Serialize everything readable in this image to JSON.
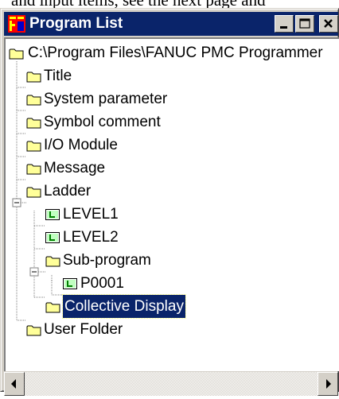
{
  "doc_snippet": "and input items, see the next page and",
  "window": {
    "title": "Program List",
    "icon": "fanuc-program-list-icon",
    "buttons": [
      "minimize",
      "maximize",
      "close"
    ]
  },
  "tree": {
    "root": "C:\\Program Files\\FANUC PMC Programmer",
    "items": [
      {
        "label": "Title",
        "icon": "folder-icon"
      },
      {
        "label": "System parameter",
        "icon": "folder-icon"
      },
      {
        "label": "Symbol comment",
        "icon": "folder-icon"
      },
      {
        "label": "I/O Module",
        "icon": "folder-icon"
      },
      {
        "label": "Message",
        "icon": "folder-icon"
      },
      {
        "label": "Ladder",
        "icon": "folder-icon",
        "expanded": true
      },
      {
        "label": "LEVEL1",
        "icon": "ladder-program-icon"
      },
      {
        "label": "LEVEL2",
        "icon": "ladder-program-icon"
      },
      {
        "label": "Sub-program",
        "icon": "folder-icon",
        "expanded": true
      },
      {
        "label": "P0001",
        "icon": "ladder-program-icon"
      },
      {
        "label": "Collective Display",
        "icon": "folder-icon",
        "selected": true
      },
      {
        "label": "User Folder",
        "icon": "folder-icon"
      }
    ]
  },
  "colors": {
    "titlebar": "#0a246a",
    "selection": "#0a246a",
    "folder": "#ffff99",
    "program_icon": "#008000"
  }
}
